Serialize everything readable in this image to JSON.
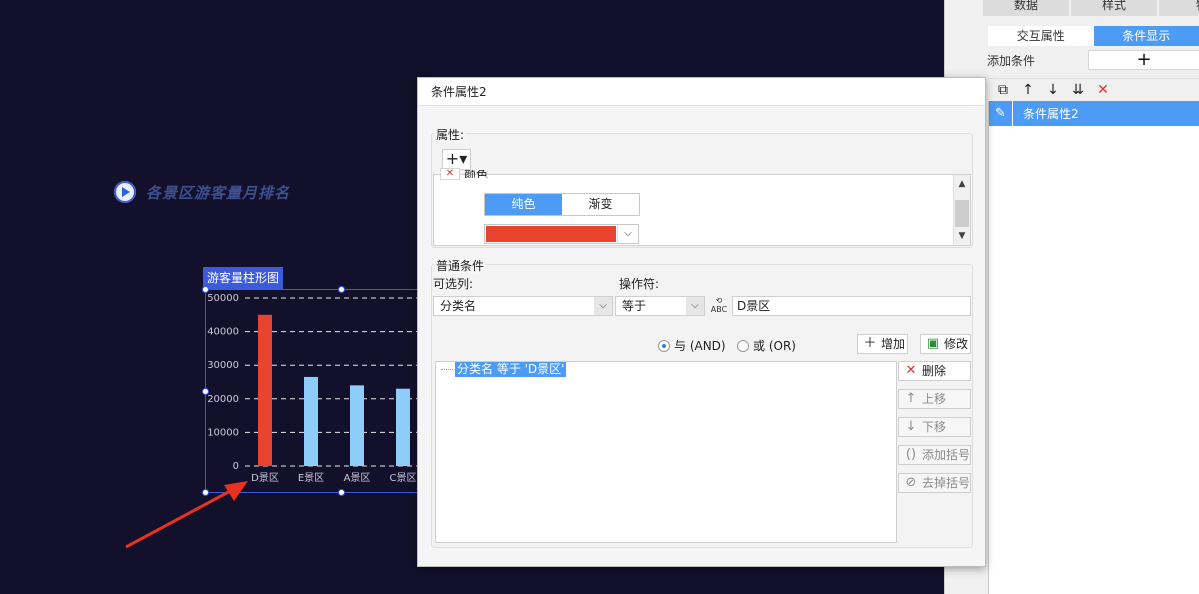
{
  "canvas": {
    "report_title": "各景区游客量月排名",
    "widget_tag": "游客量柱形图"
  },
  "chart_data": {
    "type": "bar",
    "categories": [
      "D景区",
      "E景区",
      "A景区",
      "C景区"
    ],
    "values": [
      45000,
      26500,
      24000,
      23000
    ],
    "colors": [
      "#e8432f",
      "#8ecdf8",
      "#8ecdf8",
      "#8ecdf8"
    ],
    "yticks": [
      "50000",
      "40000",
      "30000",
      "20000",
      "10000",
      "0"
    ],
    "ylim": [
      0,
      50000
    ],
    "grid": "dashed",
    "title": "",
    "xlabel": "",
    "ylabel": ""
  },
  "right_panel": {
    "top_tabs": [
      "数据",
      "样式",
      "特"
    ],
    "sub_tabs": [
      "交互属性",
      "条件显示"
    ],
    "add_condition_label": "添加条件",
    "add_condition_button": "+",
    "toolbar_icons": [
      "copy-icon",
      "arrow-up-icon",
      "arrow-down-icon",
      "move-bottom-icon",
      "delete-icon"
    ],
    "selected_item": "条件属性2"
  },
  "dialog": {
    "title": "条件属性2",
    "attr_group_label": "属性:",
    "add_attr_button": "+▾",
    "partial_row_text": "颜色",
    "color_modes": [
      "纯色",
      "渐变"
    ],
    "color_value": "#e8432f",
    "normal_cond_label": "普通条件",
    "column_label": "可选列:",
    "column_value": "分类名",
    "operator_label": "操作符:",
    "operator_value": "等于",
    "value_input": "D景区",
    "radio_and": "与 (AND)",
    "radio_or": "或 (OR)",
    "add_button": "增加",
    "modify_button": "修改",
    "delete_button": "删除",
    "move_up_button": "上移",
    "move_down_button": "下移",
    "add_bracket_button": "添加括号",
    "remove_bracket_button": "去掉括号",
    "condition_node": "分类名 等于 'D景区'"
  }
}
